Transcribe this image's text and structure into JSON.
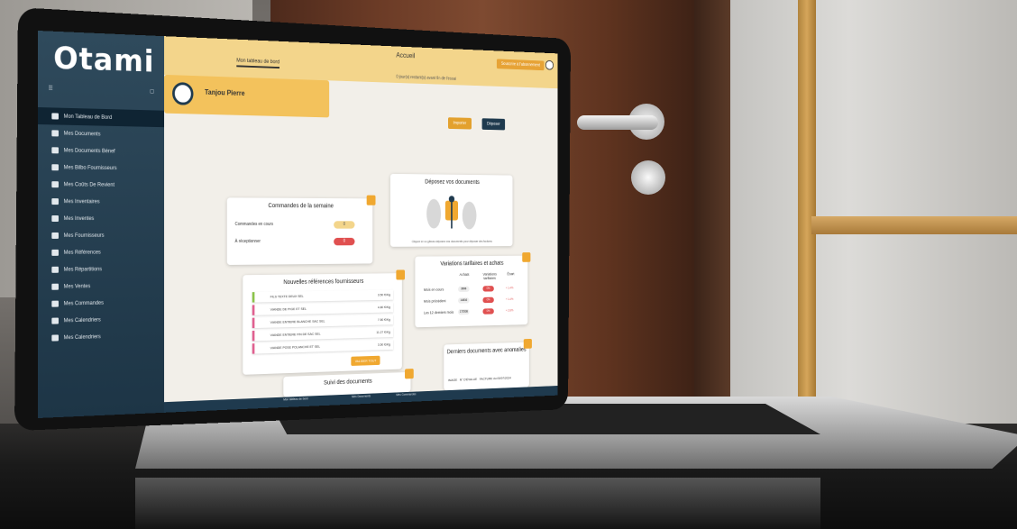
{
  "sidebar": {
    "logo": "Otami",
    "items": [
      {
        "label": "Mon Tableau de Bord",
        "active": true
      },
      {
        "label": "Mes Documents"
      },
      {
        "label": "Mes Documents Bénef"
      },
      {
        "label": "Mes Bilbo Fournisseurs"
      },
      {
        "label": "Mes Coûts De Revient"
      },
      {
        "label": "Mes Inventaires"
      },
      {
        "label": "Mes Inventes"
      },
      {
        "label": "Mes Fournisseurs"
      },
      {
        "label": "Mes Références"
      },
      {
        "label": "Mes Répartitions"
      },
      {
        "label": "Mes Ventes"
      },
      {
        "label": "Mes Commandes"
      },
      {
        "label": "Mes Calendriers"
      },
      {
        "label": "Mes Calendriers"
      }
    ]
  },
  "topbar": {
    "title": "Accueil",
    "tab": "Mon tableau de bord",
    "notice": "0 jour(s) restant(s) avant fin de l'essai",
    "cta": "Souscrire à l'abonnement"
  },
  "actions": {
    "import": "Importer",
    "depot": "Déposer"
  },
  "user": {
    "name": "Tanjou Pierre"
  },
  "orders": {
    "title": "Commandes de la semaine",
    "rows": [
      {
        "label": "Commandes en cours",
        "value": "0"
      },
      {
        "label": "À réceptionner",
        "value": "0"
      }
    ]
  },
  "refs": {
    "title": "Nouvelles références fournisseurs",
    "rows": [
      {
        "name": "FILS TEXTE DEUX SEL",
        "value": "3.50 €/Kg"
      },
      {
        "name": "VIANDE DE PIGE ET SEL",
        "value": "4.80 €/Kg"
      },
      {
        "name": "VIANDE ENTIERE BLANCHE SAC SEL",
        "value": "7.50 €/Kg"
      },
      {
        "name": "VIANDE ENTIERE FIN DE SAC SEL",
        "value": "11.27 €/Kg"
      },
      {
        "name": "VIANDE POSE POLANCHE ET SEL",
        "value": "3.50 €/Kg"
      }
    ],
    "button": "VALIDER TOUT"
  },
  "deposit": {
    "title": "Déposez vos documents",
    "caption": "Cliquez ici ou glissez-déposez vos documents pour déposer des factures"
  },
  "variations": {
    "title": "Variations tarifaires et achats",
    "headers": [
      "Achats",
      "Variations tarifaires",
      "Écart"
    ],
    "rows": [
      {
        "label": "Mois en cours",
        "achats": "2896",
        "var": "0%",
        "ecart": "+ 1.4%"
      },
      {
        "label": "Mois précédent",
        "achats": "14816",
        "var": "0%",
        "ecart": "+ 1.4%"
      },
      {
        "label": "Les 12 derniers mois",
        "achats": "172538",
        "var": "0%",
        "ecart": "+ 2.8%"
      }
    ]
  },
  "recent": {
    "title": "Derniers documents avec anomalies",
    "cols": [
      "IMAGE",
      "N° D'ÉVALUE",
      "FACTURE du 05/07/2024"
    ]
  },
  "suivi": {
    "title": "Suivi des documents"
  },
  "bottom_nav": [
    "Mon tableau de bord",
    "Mes Documents",
    "Mes Commandes"
  ],
  "colors": {
    "accent": "#f0a830",
    "navy": "#1f3a4e",
    "danger": "#e05050"
  }
}
